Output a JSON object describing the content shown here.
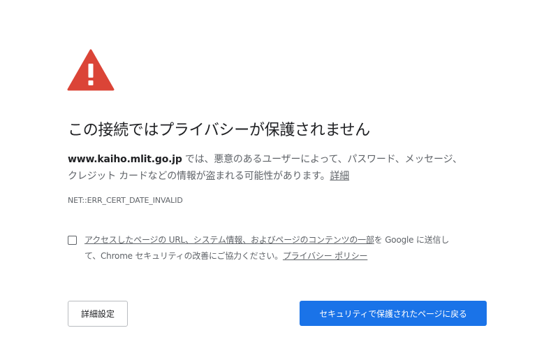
{
  "interstitial": {
    "icon": "warning-triangle-icon",
    "icon_color": "#db4437",
    "title": "この接続ではプライバシーが保護されません",
    "domain": "www.kaiho.mlit.go.jp",
    "description_line1": " では、悪意のあるユーザーによって、パスワード、メッセージ、",
    "description_line2": "クレジット カードなどの情報が盗まれる可能性があります。",
    "details_link": "詳細",
    "error_code": "NET::ERR_CERT_DATE_INVALID"
  },
  "optin": {
    "checked": false,
    "link_text": "アクセスしたページの URL、システム情報、およびページのコンテンツの一部",
    "text_mid": "を Google に送信し",
    "text_line2": "て、Chrome セキュリティの改善にご協力ください。",
    "privacy_link": "プライバシー ポリシー"
  },
  "buttons": {
    "advanced_label": "詳細設定",
    "back_to_safety_label": "セキュリティで保護されたページに戻る",
    "primary_color": "#1a73e8"
  }
}
